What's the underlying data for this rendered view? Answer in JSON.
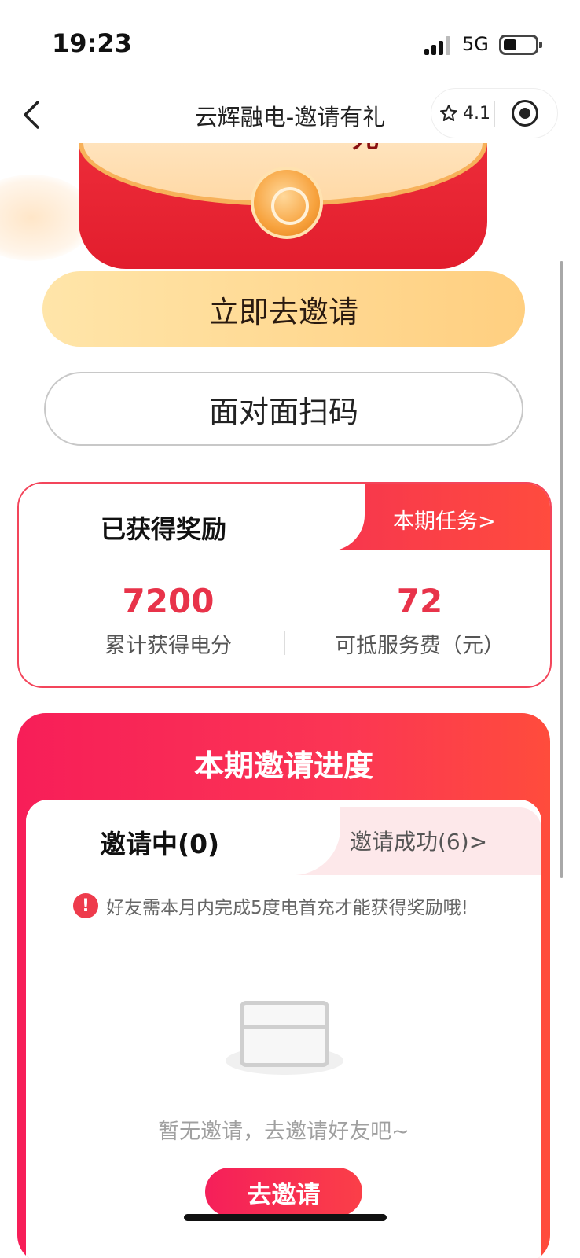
{
  "status_bar": {
    "time": "19:23",
    "network": "5G"
  },
  "nav": {
    "title": "云辉融电-邀请有礼",
    "rating": "4.1",
    "icons": [
      "back-icon",
      "star-icon",
      "target-icon"
    ]
  },
  "hero": {
    "currency": "元"
  },
  "buttons": {
    "invite_now": "立即去邀请",
    "face_scan": "面对面扫码"
  },
  "reward": {
    "title": "已获得奖励",
    "task_link": "本期任务>",
    "stats": [
      {
        "value": "7200",
        "label": "累计获得电分"
      },
      {
        "value": "72",
        "label": "可抵服务费（元）"
      }
    ]
  },
  "progress": {
    "title": "本期邀请进度",
    "tabs": {
      "active": "邀请中(0)",
      "inactive": "邀请成功(6)>"
    },
    "notice": "好友需本月内完成5度电首充才能获得奖励哦!",
    "empty_text": "暂无邀请，去邀请好友吧~",
    "invite_button": "去邀请"
  },
  "colors": {
    "accent_red": "#f3455b",
    "gold_button": "#ffd896"
  }
}
